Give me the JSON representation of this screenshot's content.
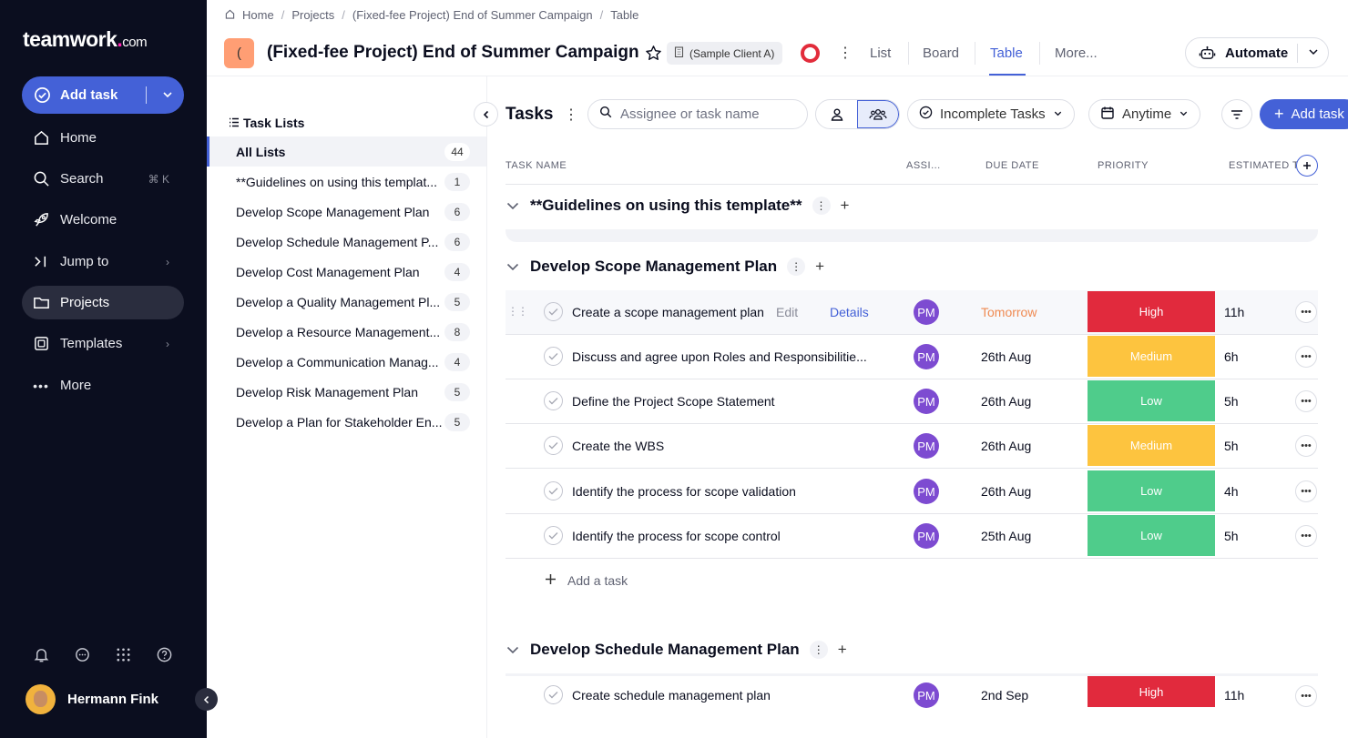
{
  "sidebar": {
    "logo_main": "teamwork",
    "logo_dot": ".",
    "logo_com": "com",
    "add_task": "Add task",
    "items": [
      {
        "label": "Home",
        "icon": "home-icon"
      },
      {
        "label": "Search",
        "icon": "search-icon",
        "shortcut": "⌘ K"
      },
      {
        "label": "Welcome",
        "icon": "rocket-icon"
      },
      {
        "label": "Jump to",
        "icon": "jump-icon"
      },
      {
        "label": "Projects",
        "icon": "folder-icon",
        "active": true
      },
      {
        "label": "Templates",
        "icon": "templates-icon"
      },
      {
        "label": "More",
        "icon": "more-icon"
      }
    ],
    "user_name": "Hermann Fink"
  },
  "breadcrumb": [
    "Home",
    "Projects",
    "(Fixed-fee Project) End of Summer Campaign",
    "Table"
  ],
  "project": {
    "icon_letter": "(",
    "title": "(Fixed-fee Project) End of Summer Campaign",
    "client": "(Sample Client A)",
    "tabs": [
      "List",
      "Board",
      "Table",
      "More..."
    ],
    "active_tab": "Table",
    "automate": "Automate"
  },
  "task_lists": {
    "title": "Task Lists",
    "items": [
      {
        "label": "All Lists",
        "count": "44"
      },
      {
        "label": "**Guidelines on using this templat...",
        "count": "1"
      },
      {
        "label": "Develop Scope Management Plan",
        "count": "6"
      },
      {
        "label": "Develop Schedule Management P...",
        "count": "6"
      },
      {
        "label": "Develop Cost Management Plan",
        "count": "4"
      },
      {
        "label": "Develop a Quality Management Pl...",
        "count": "5"
      },
      {
        "label": "Develop a Resource Management...",
        "count": "8"
      },
      {
        "label": "Develop a Communication Manag...",
        "count": "4"
      },
      {
        "label": "Develop Risk Management Plan",
        "count": "5"
      },
      {
        "label": "Develop a Plan for Stakeholder En...",
        "count": "5"
      }
    ]
  },
  "toolbar": {
    "title": "Tasks",
    "search_placeholder": "Assignee or task name",
    "incomplete": "Incomplete Tasks",
    "anytime": "Anytime",
    "add_task": "Add task"
  },
  "table": {
    "headers": [
      "TASK NAME",
      "ASSI...",
      "DUE DATE",
      "PRIORITY",
      "ESTIMATED T"
    ],
    "groups": [
      {
        "title": "**Guidelines on using this template**"
      },
      {
        "title": "Develop Scope Management Plan"
      },
      {
        "title": "Develop Schedule Management Plan"
      }
    ],
    "rows": [
      {
        "name": "Create a scope management plan",
        "assignee": "PM",
        "due": "Tomorrow",
        "priority": "High",
        "estimate": "11h"
      },
      {
        "name": "Discuss and agree upon Roles and Responsibilitie...",
        "assignee": "PM",
        "due": "26th Aug",
        "priority": "Medium",
        "estimate": "6h"
      },
      {
        "name": "Define the Project Scope Statement",
        "assignee": "PM",
        "due": "26th Aug",
        "priority": "Low",
        "estimate": "5h"
      },
      {
        "name": "Create the WBS",
        "assignee": "PM",
        "due": "26th Aug",
        "priority": "Medium",
        "estimate": "5h"
      },
      {
        "name": "Identify the process for scope validation",
        "assignee": "PM",
        "due": "26th Aug",
        "priority": "Low",
        "estimate": "4h"
      },
      {
        "name": "Identify the process for scope control",
        "assignee": "PM",
        "due": "25th Aug",
        "priority": "Low",
        "estimate": "5h"
      }
    ],
    "row_edit": "Edit",
    "row_details": "Details",
    "add_a_task": "Add a task",
    "schedule_row": {
      "name": "Create schedule management plan",
      "assignee": "PM",
      "due": "2nd Sep",
      "priority": "High",
      "estimate": "11h"
    }
  },
  "colors": {
    "accent": "#4461d7",
    "sidebar_bg": "#0b0e1f",
    "high": "#e12a3d",
    "medium": "#fdc43f",
    "low": "#4fcc8b",
    "avatar": "#7d4bd1"
  }
}
